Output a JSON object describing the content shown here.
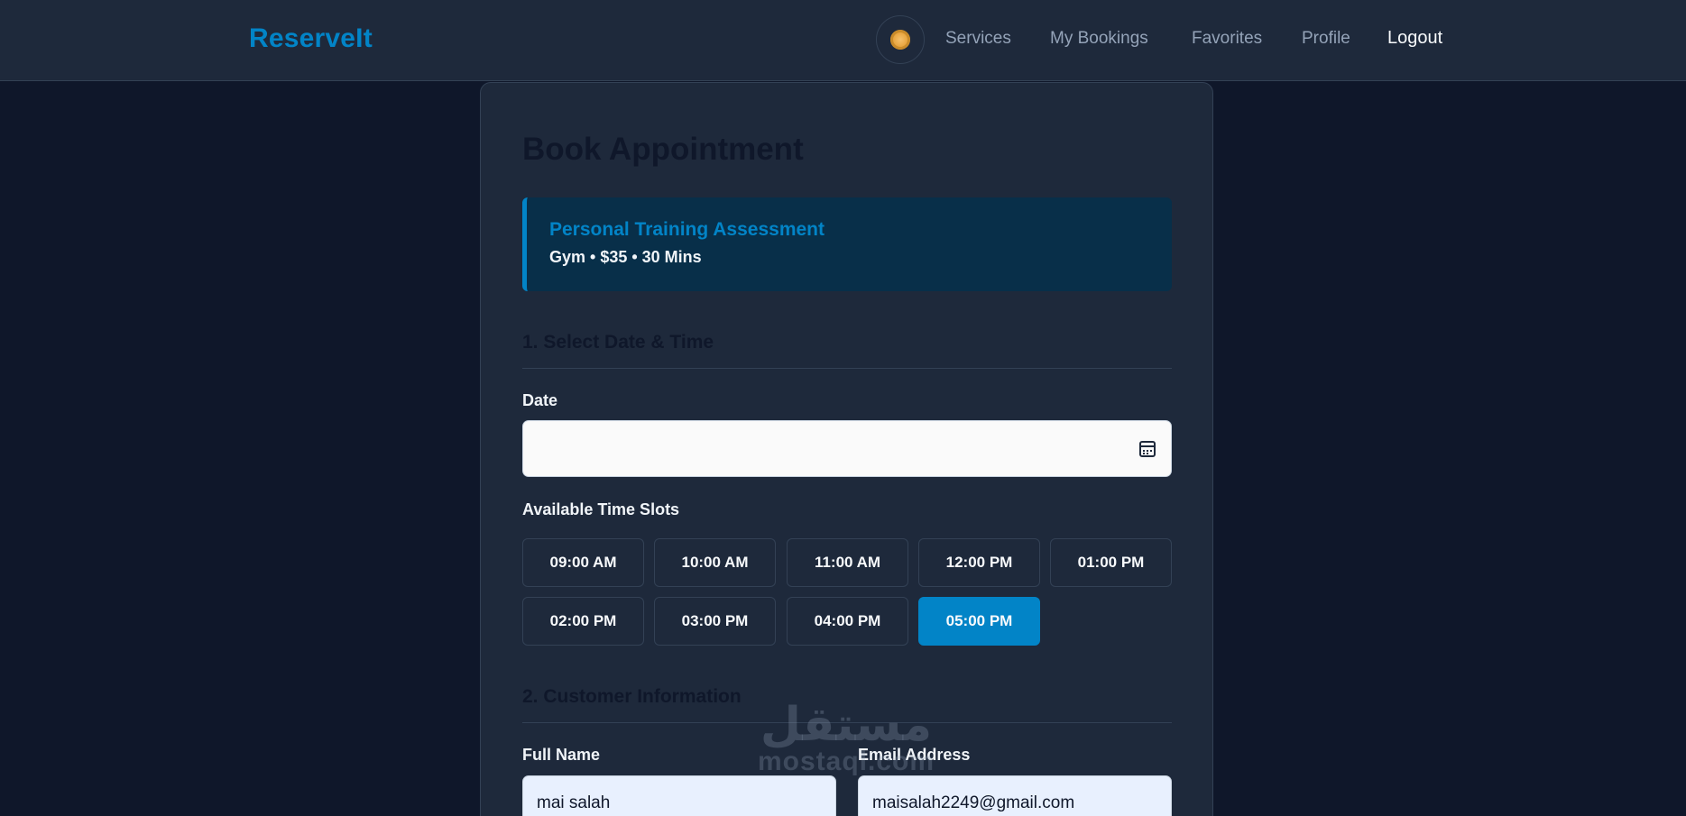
{
  "navbar": {
    "brand": "ReserveIt",
    "links": [
      "Services",
      "My Bookings",
      "Favorites",
      "Profile",
      "Logout"
    ]
  },
  "booking": {
    "title": "Book Appointment",
    "service": {
      "name": "Personal Training Assessment",
      "meta": "Gym • $35 • 30 Mins"
    },
    "section1": "1. Select Date & Time",
    "date_label": "Date",
    "date_value": "",
    "slots_label": "Available Time Slots",
    "slots": [
      "09:00 AM",
      "10:00 AM",
      "11:00 AM",
      "12:00 PM",
      "01:00 PM",
      "02:00 PM",
      "03:00 PM",
      "04:00 PM",
      "05:00 PM"
    ],
    "selected_slot": "05:00 PM",
    "section2": "2. Customer Information",
    "full_name_label": "Full Name",
    "full_name_value": "mai salah",
    "email_label": "Email Address",
    "email_value": "maisalah2249@gmail.com"
  },
  "watermark": {
    "arabic": "مستقل",
    "latin": "mostaql.com"
  },
  "colors": {
    "page_bg": "#0f172a",
    "surface": "#1e293b",
    "accent": "#0284c7",
    "service_bg": "#082f49"
  },
  "icons": [
    "sun-icon",
    "calendar-icon"
  ]
}
